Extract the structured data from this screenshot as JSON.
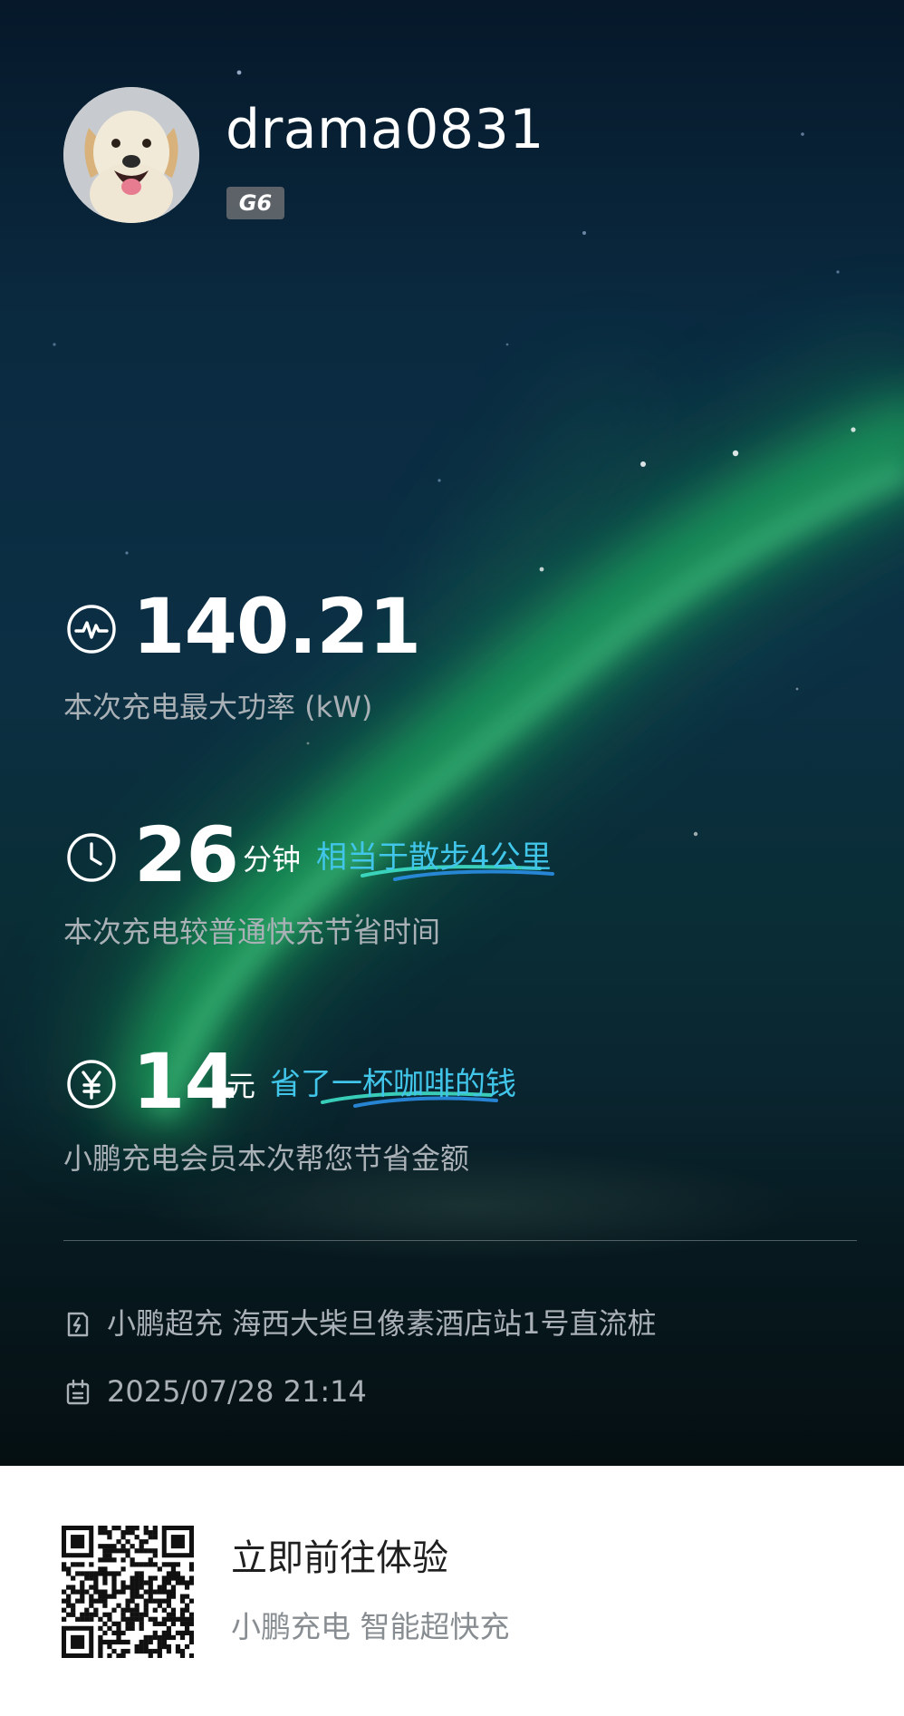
{
  "profile": {
    "username": "drama0831",
    "badge": "G6"
  },
  "stats": {
    "power": {
      "icon": "activity-pulse-icon",
      "value": "140.21",
      "desc": "本次充电最大功率 (kW)"
    },
    "time": {
      "icon": "clock-icon",
      "value": "26",
      "unit": "分钟",
      "highlight": "相当于散步4公里",
      "desc": "本次充电较普通快充节省时间"
    },
    "money": {
      "icon": "yuan-icon",
      "value": "14",
      "unit": "元",
      "highlight": "省了一杯咖啡的钱",
      "desc": "小鹏充电会员本次帮您节省金额"
    }
  },
  "meta": {
    "station": "小鹏超充 海西大柴旦像素酒店站1号直流桩",
    "datetime": "2025/07/28 21:14"
  },
  "footer": {
    "cta_title": "立即前往体验",
    "cta_sub": "小鹏充电 智能超快充"
  },
  "colors": {
    "highlight": "#41c6ea",
    "aurora": "#1fbf62",
    "background_top": "#06182a",
    "description_text": "#aab1b6"
  }
}
